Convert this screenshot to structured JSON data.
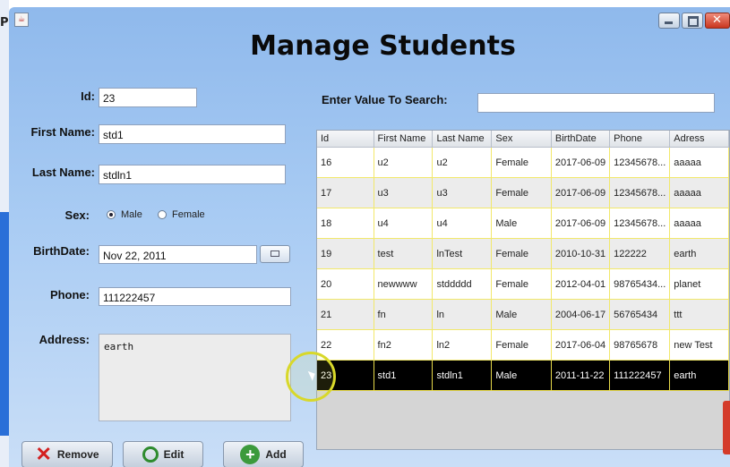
{
  "desktop": {
    "partial_text": "Pe"
  },
  "window": {
    "title": "Manage Students",
    "controls": [
      "minimize-icon",
      "maximize-icon",
      "close-icon"
    ]
  },
  "form": {
    "id_label": "Id:",
    "id_value": "23",
    "first_name_label": "First Name:",
    "first_name_value": "std1",
    "last_name_label": "Last Name:",
    "last_name_value": "stdln1",
    "sex_label": "Sex:",
    "sex_options": [
      "Male",
      "Female"
    ],
    "sex_selected": "Male",
    "birthdate_label": "BirthDate:",
    "birthdate_value": "Nov 22, 2011",
    "phone_label": "Phone:",
    "phone_value": "111222457",
    "address_label": "Address:",
    "address_value": "earth"
  },
  "search": {
    "label": "Enter Value To Search:",
    "value": ""
  },
  "table": {
    "columns": [
      "Id",
      "First Name",
      "Last Name",
      "Sex",
      "BirthDate",
      "Phone",
      "Adress"
    ],
    "rows": [
      [
        "16",
        "u2",
        "u2",
        "Female",
        "2017-06-09",
        "12345678...",
        "aaaaa"
      ],
      [
        "17",
        "u3",
        "u3",
        "Female",
        "2017-06-09",
        "12345678...",
        "aaaaa"
      ],
      [
        "18",
        "u4",
        "u4",
        "Male",
        "2017-06-09",
        "12345678...",
        "aaaaa"
      ],
      [
        "19",
        "test",
        "lnTest",
        "Female",
        "2010-10-31",
        "122222",
        "earth"
      ],
      [
        "20",
        "newwww",
        "stddddd",
        "Female",
        "2012-04-01",
        "98765434...",
        "planet"
      ],
      [
        "21",
        "fn",
        "ln",
        "Male",
        "2004-06-17",
        "56765434",
        "ttt"
      ],
      [
        "22",
        "fn2",
        "ln2",
        "Female",
        "2017-06-04",
        "98765678",
        "new Test"
      ],
      [
        "23",
        "std1",
        "stdln1",
        "Male",
        "2011-11-22",
        "111222457",
        "earth"
      ]
    ],
    "selected_row_index": 7
  },
  "buttons": {
    "remove": "Remove",
    "edit": "Edit",
    "add": "Add"
  },
  "colors": {
    "window_bg": "#a8cbf3",
    "selected_row": "#000000",
    "grid_line": "#f2e86a",
    "remove_icon": "#d31f1f",
    "add_icon": "#3c9a3c"
  }
}
